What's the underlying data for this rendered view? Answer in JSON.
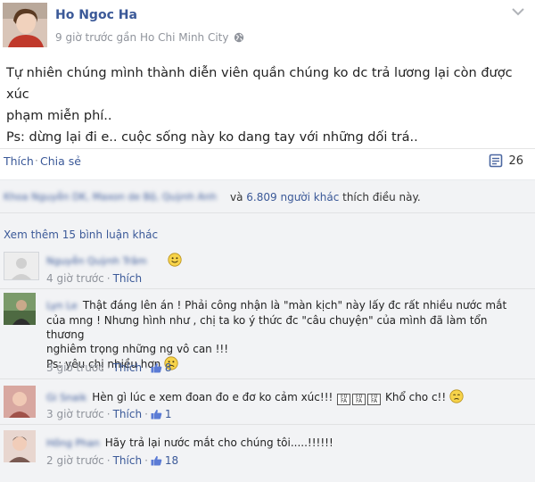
{
  "post": {
    "author": "Ho Ngoc Ha",
    "meta": "9 giờ trước gần Ho Chi Minh City",
    "text_line1": "Tự nhiên chúng mình thành diễn viên quần chúng ko dc trả lương lại còn được xúc",
    "text_line2": "phạm miễn phí..",
    "text_line3": "Ps: dừng lại đi e.. cuộc sống này ko dang tay với những dối trá.."
  },
  "actions": {
    "like": "Thích",
    "separator": "·",
    "share": "Chia sẻ",
    "comment_count": "26"
  },
  "likes": {
    "names_blurred": "Khoa Nguyễn DK, Maxon de Bộ, Quỳnh Anh",
    "and": "và",
    "others": "6.809 người khác",
    "suffix": "thích điều này."
  },
  "comments": {
    "view_more": "Xem thêm 15 bình luận khác",
    "items": [
      {
        "name_blurred": "Nguyễn Quỳnh Trâm",
        "text": "",
        "time": "4 giờ trước",
        "like": "Thích",
        "likes": ""
      },
      {
        "name_blurred": "Lyn Le",
        "text_line1": "Thật đáng lên án ! Phải công nhận là \"màn kịch\" này lấy đc rất nhiều nước mắt",
        "text_line2": "của mng ! Nhưng hình như , chị ta ko ý thức đc \"câu chuyện\" của mình đã làm tổn thương",
        "text_line3": "nghiêm trọng những ng vô can !!!",
        "text_line4": "Ps: yêu chị nhiều hơn",
        "time": "3 giờ trước",
        "like": "Thích",
        "likes": "8"
      },
      {
        "name_blurred": "Gi Snaik",
        "text_a": "Hèn gì lúc e xem đoan đo e đơ ko cảm xúc!!!",
        "text_b": "Khổ cho c!!",
        "time": "3 giờ trước",
        "like": "Thích",
        "likes": "1"
      },
      {
        "name_blurred": "Hồng Phan",
        "text": "Hãy trả lại nước mắt cho chúng tôi.....!!!!!!",
        "time": "2 giờ trước",
        "like": "Thích",
        "likes": "18"
      }
    ]
  },
  "icons": {
    "globe": "globe-icon",
    "chevron": "chevron-down-icon",
    "comment": "comment-icon",
    "thumb": "thumbs-up-icon",
    "emoji_smile": "smile-emoji-icon",
    "emoji_sad": "sad-emoji-icon",
    "emoji_cry": "crying-emoji-icon"
  },
  "colors": {
    "link": "#3b5998",
    "muted": "#90949c",
    "panel": "#f2f3f5"
  }
}
